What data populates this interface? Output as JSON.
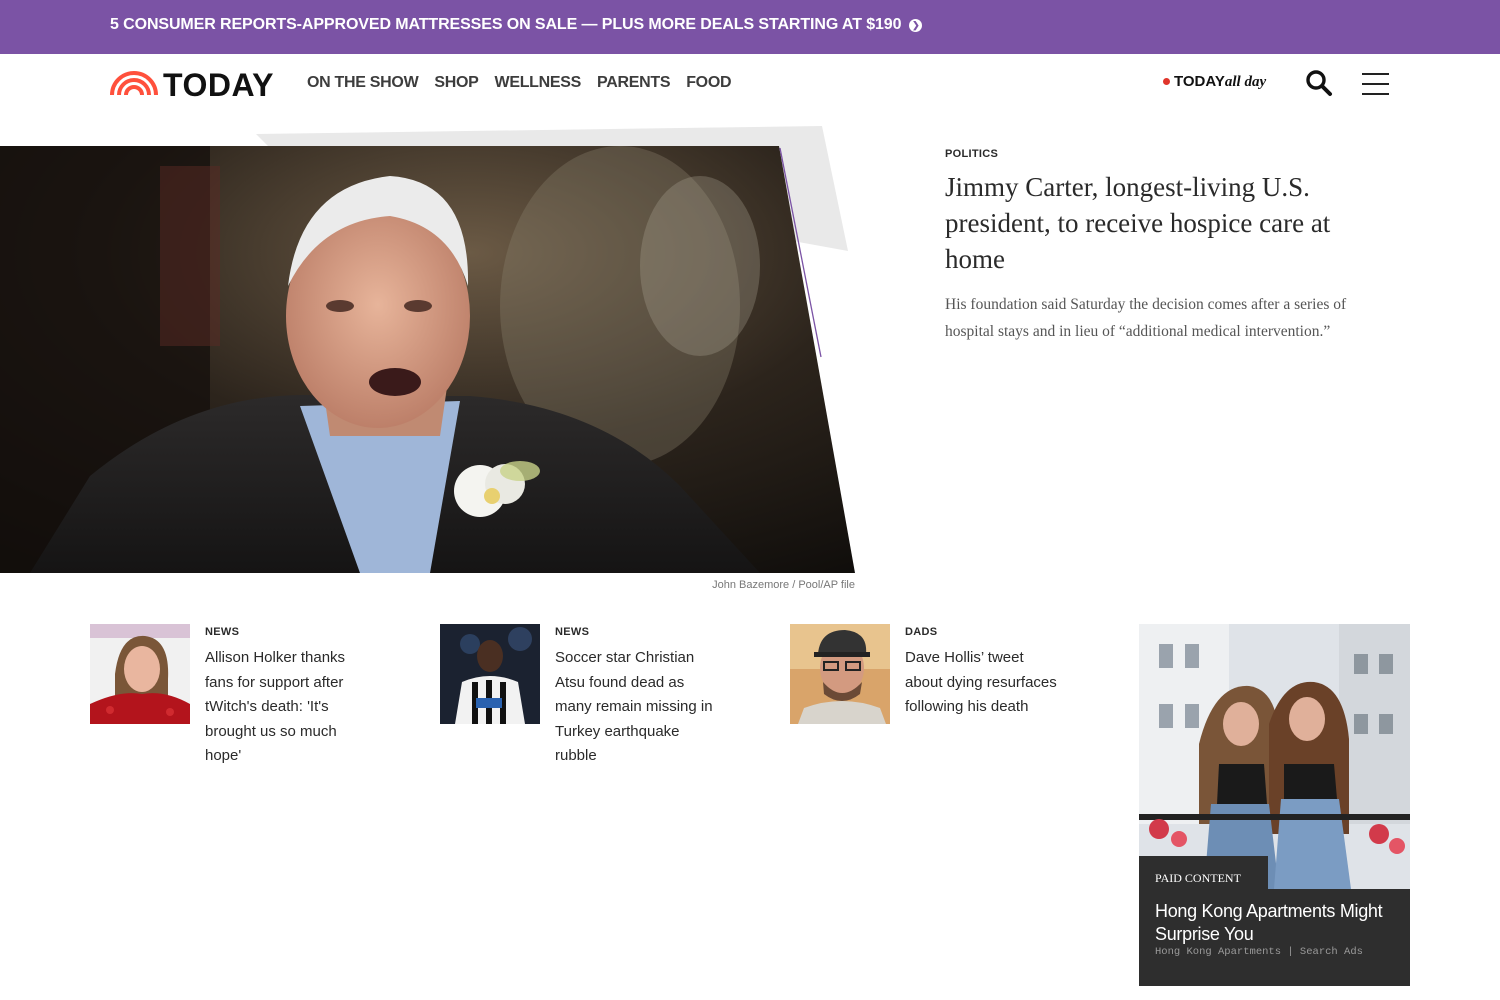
{
  "promo": {
    "text": "5 CONSUMER REPORTS-APPROVED MATTRESSES ON SALE — PLUS MORE DEALS STARTING AT $190",
    "arrow_icon": "chevron-right-circle-icon",
    "background": "#7b53a5"
  },
  "header": {
    "logo_text": "TODAY",
    "nav": [
      "ON THE SHOW",
      "SHOP",
      "WELLNESS",
      "PARENTS",
      "FOOD"
    ],
    "allday_brand": "TODAY",
    "allday_sub": "all day",
    "search_icon": "search-icon",
    "menu_icon": "hamburger-menu-icon"
  },
  "hero": {
    "eyebrow": "POLITICS",
    "title": "Jimmy Carter, longest-living U.S. president, to receive hospice care at home",
    "dek": "His foundation said Saturday the decision comes after a series of hospital stays and in lieu of “additional medical intervention.”",
    "credit": "John Bazemore / Pool/AP file"
  },
  "cards": [
    {
      "eyebrow": "NEWS",
      "title": "Allison Holker thanks fans for support after tWitch's death: 'It's brought us so much hope'"
    },
    {
      "eyebrow": "NEWS",
      "title": "Soccer star Christian Atsu found dead as many remain missing in Turkey earthquake rubble"
    },
    {
      "eyebrow": "DADS",
      "title": "Dave Hollis’ tweet about dying resurfaces following his death"
    }
  ],
  "ad": {
    "badge": "PAID CONTENT",
    "title": "Hong Kong Apartments Might Surprise You",
    "source": "Hong Kong Apartments | Search Ads"
  },
  "colors": {
    "accent_purple": "#7b53a5",
    "logo_orange": "#ff503c",
    "live_dot": "#e0352b"
  }
}
